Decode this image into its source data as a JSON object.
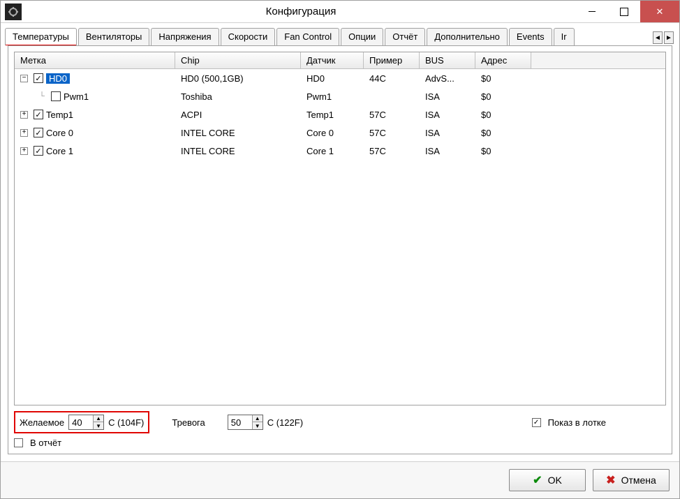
{
  "window": {
    "title": "Конфигурация"
  },
  "tabs": {
    "items": [
      "Температуры",
      "Вентиляторы",
      "Напряжения",
      "Скорости",
      "Fan Control",
      "Опции",
      "Отчёт",
      "Дополнительно",
      "Events",
      "Ir"
    ],
    "active_index": 0
  },
  "columns": {
    "label": "Метка",
    "chip": "Chip",
    "sensor": "Датчик",
    "sample": "Пример",
    "bus": "BUS",
    "addr": "Адрес"
  },
  "rows": [
    {
      "indent": 0,
      "expander": "-",
      "checked": true,
      "selected": true,
      "label": "HD0",
      "chip": "HD0 (500,1GB)",
      "sensor": "HD0",
      "sample": "44C",
      "bus": "AdvS...",
      "addr": "$0"
    },
    {
      "indent": 1,
      "expander": "",
      "checked": false,
      "selected": false,
      "label": "Pwm1",
      "chip": "Toshiba",
      "sensor": "Pwm1",
      "sample": "",
      "bus": "ISA",
      "addr": "$0",
      "leaf": true
    },
    {
      "indent": 0,
      "expander": "+",
      "checked": true,
      "selected": false,
      "label": "Temp1",
      "chip": "ACPI",
      "sensor": "Temp1",
      "sample": "57C",
      "bus": "ISA",
      "addr": "$0"
    },
    {
      "indent": 0,
      "expander": "+",
      "checked": true,
      "selected": false,
      "label": "Core 0",
      "chip": "INTEL CORE",
      "sensor": "Core 0",
      "sample": "57C",
      "bus": "ISA",
      "addr": "$0"
    },
    {
      "indent": 0,
      "expander": "+",
      "checked": true,
      "selected": false,
      "label": "Core 1",
      "chip": "INTEL CORE",
      "sensor": "Core 1",
      "sample": "57C",
      "bus": "ISA",
      "addr": "$0"
    }
  ],
  "controls": {
    "desired_label": "Желаемое",
    "desired_value": "40",
    "desired_suffix": "C (104F)",
    "alarm_label": "Тревога",
    "alarm_value": "50",
    "alarm_suffix": "C (122F)",
    "show_tray_label": "Показ в лотке",
    "show_tray_checked": true,
    "in_report_label": "В отчёт",
    "in_report_checked": false
  },
  "buttons": {
    "ok": "OK",
    "cancel": "Отмена"
  }
}
